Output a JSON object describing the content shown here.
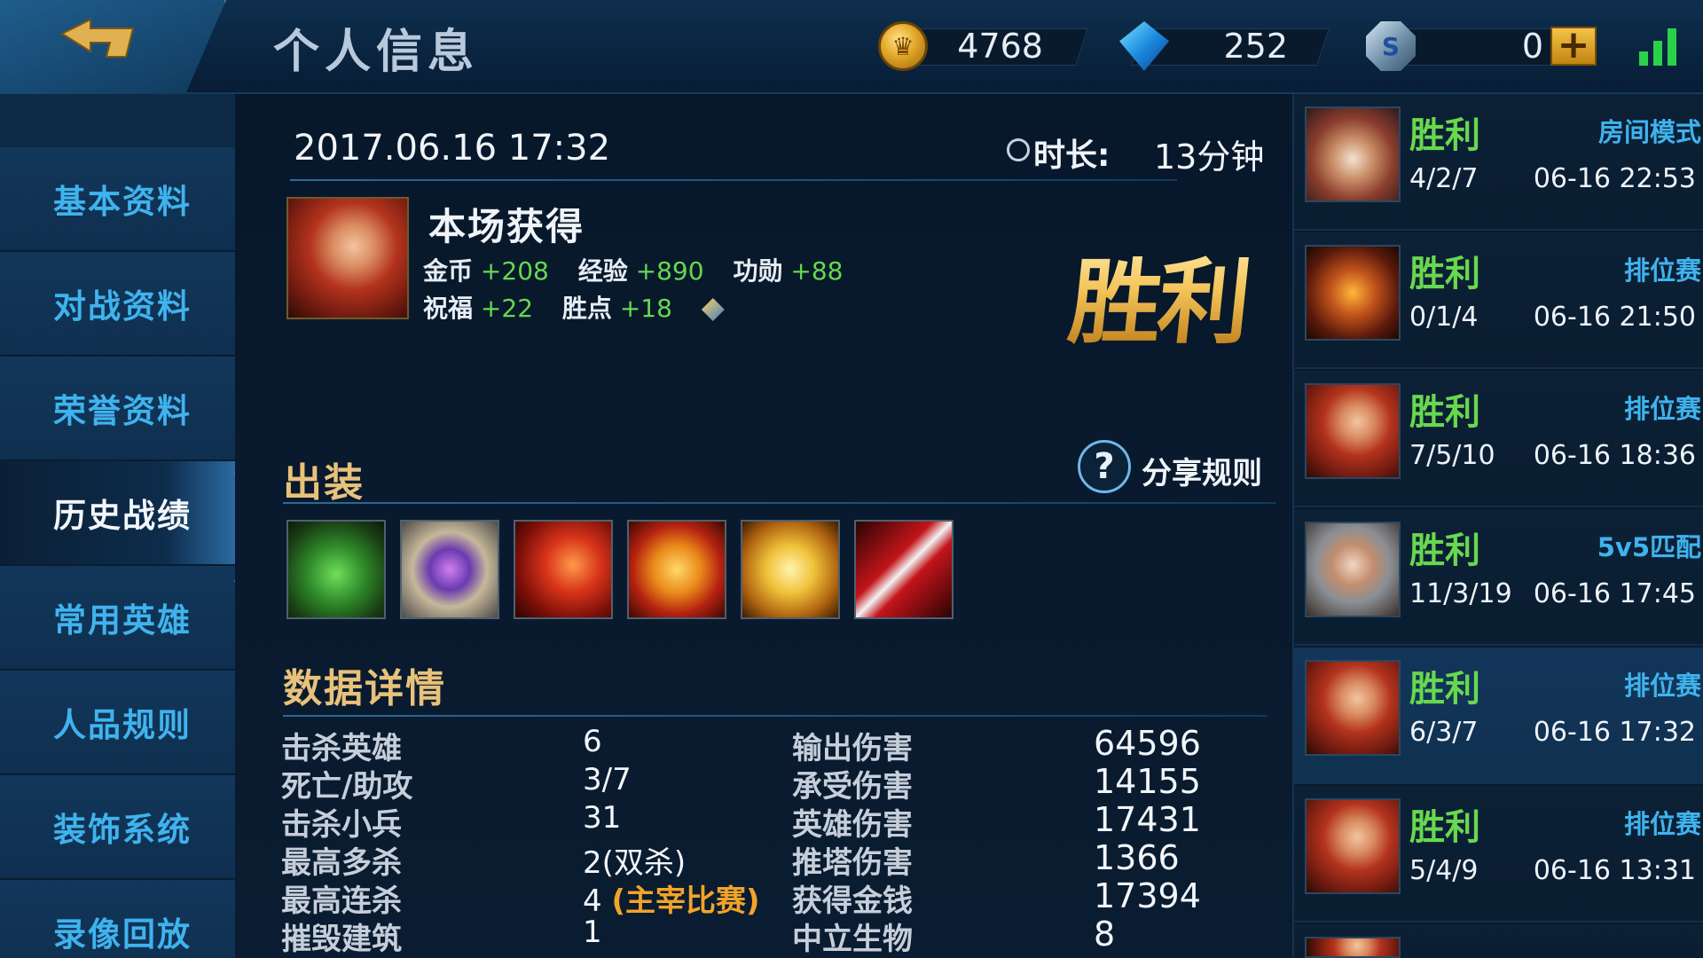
{
  "header": {
    "title": "个人信息",
    "gold": "4768",
    "diamonds": "252",
    "vouchers": "0",
    "plus_label": "+"
  },
  "sidebar": {
    "items": [
      {
        "label": "基本资料",
        "active": false
      },
      {
        "label": "对战资料",
        "active": false
      },
      {
        "label": "荣誉资料",
        "active": false
      },
      {
        "label": "历史战绩",
        "active": true
      },
      {
        "label": "常用英雄",
        "active": false
      },
      {
        "label": "人品规则",
        "active": false
      },
      {
        "label": "装饰系统",
        "active": false
      },
      {
        "label": "录像回放",
        "active": false
      }
    ]
  },
  "match_detail": {
    "datetime": "2017.06.16 17:32",
    "duration_label": "时长:",
    "duration_value": "13分钟",
    "earned_title": "本场获得",
    "earn": {
      "gold_label": "金币",
      "gold_value": "+208",
      "exp_label": "经验",
      "exp_value": "+890",
      "merit_label": "功勋",
      "merit_value": "+88",
      "blessing_label": "祝福",
      "blessing_value": "+22",
      "points_label": "胜点",
      "points_value": "+18"
    },
    "result": "胜利",
    "equipment_title": "出装",
    "share_icon": "?",
    "share_label": "分享规则",
    "items": [
      "boots-icon",
      "shield-orb-icon",
      "blade-icon",
      "mask-icon",
      "scroll-icon",
      "claw-icon"
    ],
    "data_title": "数据详情",
    "stats_left": [
      {
        "label": "击杀英雄",
        "value": "6",
        "note": ""
      },
      {
        "label": "死亡/助攻",
        "value": "3/7",
        "note": ""
      },
      {
        "label": "击杀小兵",
        "value": "31",
        "note": ""
      },
      {
        "label": "最高多杀",
        "value": "2(双杀)",
        "note": ""
      },
      {
        "label": "最高连杀",
        "value": "4",
        "note": "(主宰比赛)"
      },
      {
        "label": "摧毁建筑",
        "value": "1",
        "note": ""
      }
    ],
    "stats_right": [
      {
        "label": "输出伤害",
        "value": "64596"
      },
      {
        "label": "承受伤害",
        "value": "14155"
      },
      {
        "label": "英雄伤害",
        "value": "17431"
      },
      {
        "label": "推塔伤害",
        "value": "1366"
      },
      {
        "label": "获得金钱",
        "value": "17394"
      },
      {
        "label": "中立生物",
        "value": "8"
      }
    ]
  },
  "match_list": [
    {
      "result": "胜利",
      "mode": "房间模式",
      "kda": "4/2/7",
      "time": "06-16 22:53",
      "portrait": "dwarf"
    },
    {
      "result": "胜利",
      "mode": "排位赛",
      "kda": "0/1/4",
      "time": "06-16 21:50",
      "portrait": "beast"
    },
    {
      "result": "胜利",
      "mode": "排位赛",
      "kda": "7/5/10",
      "time": "06-16 18:36",
      "portrait": "red"
    },
    {
      "result": "胜利",
      "mode": "5v5匹配",
      "kda": "11/3/19",
      "time": "06-16 17:45",
      "portrait": "white"
    },
    {
      "result": "胜利",
      "mode": "排位赛",
      "kda": "6/3/7",
      "time": "06-16 17:32",
      "portrait": "red",
      "selected": true
    },
    {
      "result": "胜利",
      "mode": "排位赛",
      "kda": "5/4/9",
      "time": "06-16 13:31",
      "portrait": "red"
    }
  ],
  "colors": {
    "win_green": "#67d84f",
    "accent_blue": "#3fb3ee",
    "gold": "#e8c27a",
    "orange_note": "#f2a32a"
  }
}
